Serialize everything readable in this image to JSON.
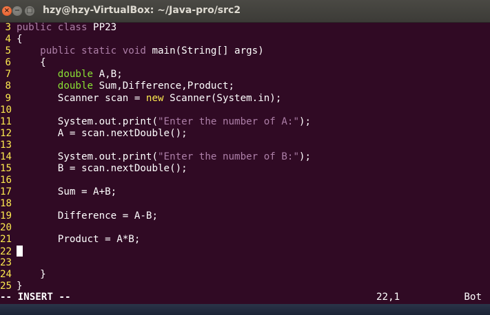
{
  "window": {
    "title": "hzy@hzy-VirtualBox: ~/Java-pro/src2",
    "close_glyph": "×",
    "minimize_glyph": "−",
    "maximize_glyph": "□"
  },
  "editor": {
    "lines": [
      {
        "num": "3",
        "code": "public class PP23"
      },
      {
        "num": "4",
        "code": "{"
      },
      {
        "num": "5",
        "code": "    public static void main(String[] args)"
      },
      {
        "num": "6",
        "code": "    {"
      },
      {
        "num": "7",
        "code": "       double A,B;"
      },
      {
        "num": "8",
        "code": "       double Sum,Difference,Product;"
      },
      {
        "num": "9",
        "code": "       Scanner scan = new Scanner(System.in);"
      },
      {
        "num": "10",
        "code": ""
      },
      {
        "num": "11",
        "code": "       System.out.print(\"Enter the number of A:\");"
      },
      {
        "num": "12",
        "code": "       A = scan.nextDouble();"
      },
      {
        "num": "13",
        "code": ""
      },
      {
        "num": "14",
        "code": "       System.out.print(\"Enter the number of B:\");"
      },
      {
        "num": "15",
        "code": "       B = scan.nextDouble();"
      },
      {
        "num": "16",
        "code": ""
      },
      {
        "num": "17",
        "code": "       Sum = A+B;"
      },
      {
        "num": "18",
        "code": ""
      },
      {
        "num": "19",
        "code": "       Difference = A-B;"
      },
      {
        "num": "20",
        "code": ""
      },
      {
        "num": "21",
        "code": "       Product = A*B;"
      },
      {
        "num": "22",
        "code": ""
      },
      {
        "num": "23",
        "code": ""
      },
      {
        "num": "24",
        "code": "    }"
      },
      {
        "num": "25",
        "code": "}"
      }
    ],
    "cursor_line": "22",
    "colors": {
      "background": "#300a24",
      "line_numbers": "#fce94f",
      "keywords": "#ad7fa8",
      "types": "#8ae234",
      "operator_new": "#fce94f",
      "strings": "#ad7fa8",
      "text": "#ffffff"
    }
  },
  "status": {
    "mode": "-- INSERT --",
    "position": "22,1",
    "scroll": "Bot"
  }
}
